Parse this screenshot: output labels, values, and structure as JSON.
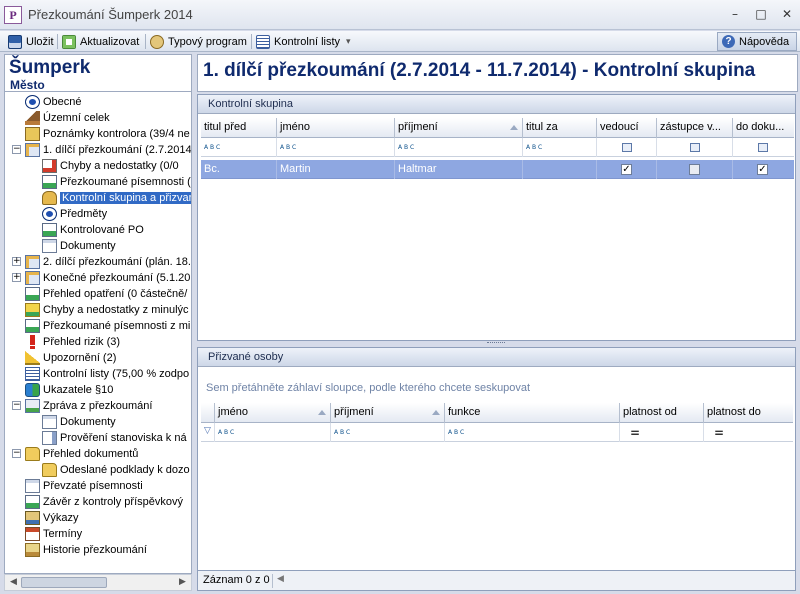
{
  "window": {
    "title": "Přezkoumání Šumperk 2014",
    "icon_letter": "P",
    "controls": [
      "–",
      "□",
      "✕"
    ]
  },
  "toolbar": {
    "save_label": "Uložit",
    "refresh_label": "Aktualizovat",
    "typical_label": "Typový program",
    "checklists_label": "Kontrolní listy",
    "dropdown_caret": "▾",
    "help_label": "Nápověda",
    "help_glyph": "?"
  },
  "left": {
    "org_name": "Šumperk",
    "org_type": "Město"
  },
  "tree": [
    {
      "label": "Obecné",
      "icon": "info-icon"
    },
    {
      "label": "Územní celek",
      "icon": "home-icon"
    },
    {
      "label": "Poznámky kontrolora (39/4 ne",
      "icon": "notes-icon"
    },
    {
      "label": "1. dílčí přezkoumání (2.7.2014",
      "icon": "review-icon"
    },
    {
      "label": "Chyby a nedostatky (0/0",
      "icon": "errors-icon"
    },
    {
      "label": "Přezkoumané písemnosti (",
      "icon": "checked-doc-icon"
    },
    {
      "label": "Kontrolní skupina a přizvar",
      "icon": "group-icon"
    },
    {
      "label": "Předměty",
      "icon": "info-icon"
    },
    {
      "label": "Kontrolované PO",
      "icon": "checked-doc-icon"
    },
    {
      "label": "Dokumenty",
      "icon": "document-icon"
    },
    {
      "label": "2. dílčí přezkoumání (plán. 18.",
      "icon": "review-icon"
    },
    {
      "label": "Konečné přezkoumání (5.1.20",
      "icon": "review-icon"
    },
    {
      "label": "Přehled opatření (0 částečně/",
      "icon": "checked-doc-icon"
    },
    {
      "label": "Chyby a nedostatky z minulýc",
      "icon": "warning-check-icon"
    },
    {
      "label": "Přezkoumané písemnosti z mir",
      "icon": "checked-doc-icon"
    },
    {
      "label": "Přehled rizik (3)",
      "icon": "risk-icon"
    },
    {
      "label": "Upozornění (2)",
      "icon": "alert-icon"
    },
    {
      "label": "Kontrolní listy (75,00 % zodpo",
      "icon": "list-icon"
    },
    {
      "label": "Ukazatele §10",
      "icon": "indicators-icon"
    },
    {
      "label": "Zpráva z přezkoumání",
      "icon": "report-icon"
    },
    {
      "label": "Dokumenty",
      "icon": "document-icon"
    },
    {
      "label": "Prověření stanoviska k ná",
      "icon": "verify-icon"
    },
    {
      "label": "Přehled dokumentů",
      "icon": "folder-icon"
    },
    {
      "label": "Odeslané podklady k dozo",
      "icon": "folder-icon"
    },
    {
      "label": "Převzaté písemnosti",
      "icon": "document-icon"
    },
    {
      "label": "Závěr z kontroly příspěvkový",
      "icon": "checked-doc-icon"
    },
    {
      "label": "Výkazy",
      "icon": "statements-icon"
    },
    {
      "label": "Termíny",
      "icon": "calendar-icon"
    },
    {
      "label": "Historie přezkoumání",
      "icon": "history-icon"
    }
  ],
  "main_title": "1. dílčí přezkoumání (2.7.2014 - 11.7.2014) - Kontrolní skupina",
  "control_group": {
    "title": "Kontrolní skupina",
    "columns": [
      "titul před",
      "jméno",
      "příjmení",
      "titul za",
      "vedoucí",
      "zástupce v...",
      "do doku..."
    ],
    "filter_placeholder": "A B C",
    "rows": [
      {
        "title_before": "Bc.",
        "first_name": "Martin",
        "last_name": "Haltmar",
        "title_after": "",
        "leader": true,
        "deputy": false,
        "to_doc": true
      }
    ],
    "check_mark": "✓"
  },
  "invited": {
    "title": "Přizvané osoby",
    "group_hint": "Sem přetáhněte záhlaví sloupce, podle kterého chcete seskupovat",
    "columns": [
      "jméno",
      "příjmení",
      "funkce",
      "platnost od",
      "platnost do"
    ],
    "filter_eq": "="
  },
  "status": {
    "records": "Záznam 0 z 0",
    "scroll_left": "◀"
  },
  "scroll": {
    "left": "◀",
    "right": "▶"
  }
}
